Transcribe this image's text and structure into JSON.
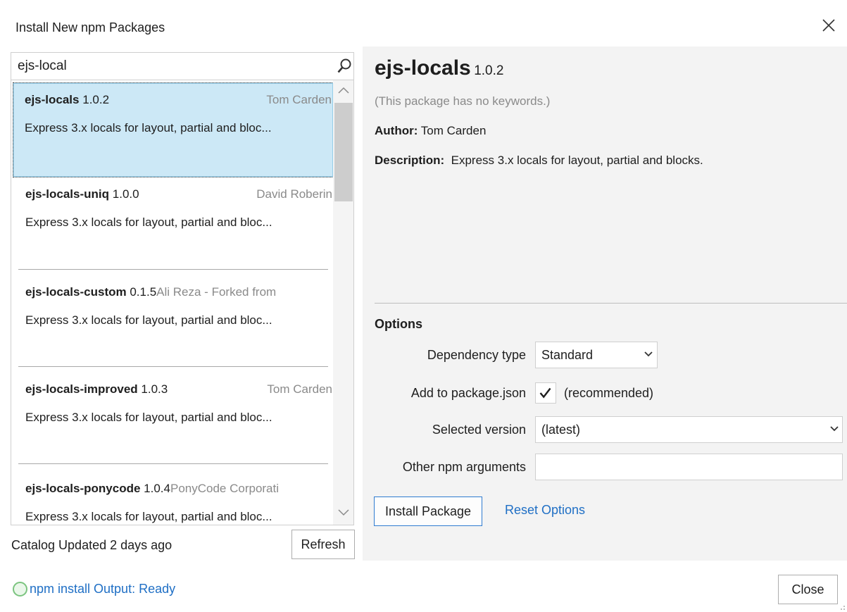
{
  "window": {
    "title": "Install New npm Packages"
  },
  "search": {
    "value": "ejs-local"
  },
  "results": [
    {
      "name": "ejs-locals",
      "version": "1.0.2",
      "author": "Tom Carden",
      "description": "Express 3.x locals for layout, partial and bloc..."
    },
    {
      "name": "ejs-locals-uniq",
      "version": "1.0.0",
      "author": "David Roberin",
      "description": "Express 3.x locals for layout, partial and bloc..."
    },
    {
      "name": "ejs-locals-custom",
      "version": "0.1.5",
      "author": "Ali Reza - Forked from",
      "description": "Express 3.x locals for layout, partial and bloc..."
    },
    {
      "name": "ejs-locals-improved",
      "version": "1.0.3",
      "author": "Tom Carden",
      "description": "Express 3.x locals for layout, partial and bloc..."
    },
    {
      "name": "ejs-locals-ponycode",
      "version": "1.0.4",
      "author": "PonyCode Corporati",
      "description": "Express 3.x locals for layout, partial and bloc..."
    }
  ],
  "catalog": {
    "status": "Catalog Updated 2 days ago",
    "refresh_label": "Refresh"
  },
  "status": {
    "output_label": "npm install Output: Ready"
  },
  "detail": {
    "name": "ejs-locals",
    "version": "1.0.2",
    "keywords": "(This package has no keywords.)",
    "author_label": "Author:",
    "author": "Tom Carden",
    "description_label": "Description:",
    "description": "Express 3.x locals for layout, partial and blocks."
  },
  "options": {
    "heading": "Options",
    "dependency_type_label": "Dependency type",
    "dependency_type_value": "Standard",
    "add_to_package_label": "Add to package.json",
    "add_to_package_checked": true,
    "add_to_package_hint": "(recommended)",
    "selected_version_label": "Selected version",
    "selected_version_value": "(latest)",
    "other_args_label": "Other npm arguments",
    "other_args_value": "",
    "install_label": "Install Package",
    "reset_label": "Reset Options"
  },
  "footer": {
    "close_label": "Close"
  },
  "colors": {
    "accent": "#1f6fc5",
    "selection": "#cce8f6",
    "ready": "#7bc47f"
  }
}
